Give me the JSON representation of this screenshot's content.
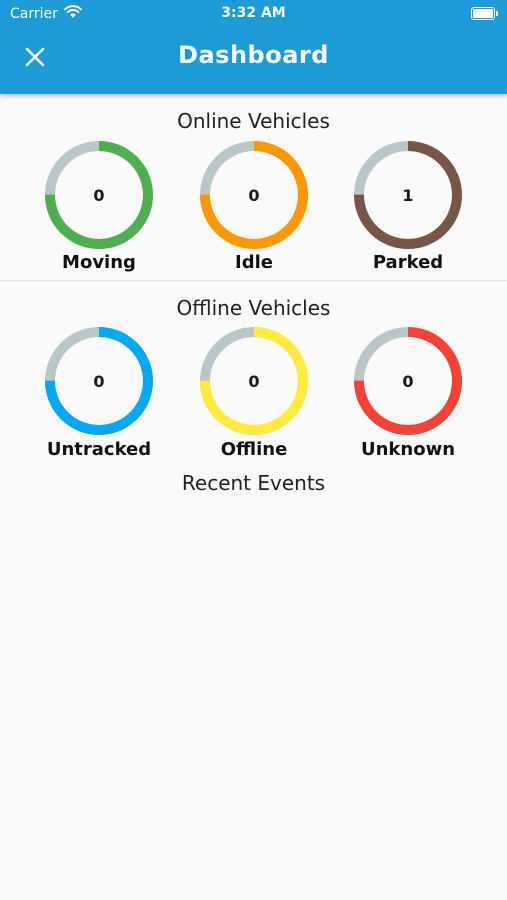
{
  "status_bar": {
    "carrier": "Carrier",
    "time": "3:32 AM"
  },
  "header": {
    "title": "Dashboard",
    "close_icon": "close-icon"
  },
  "colors": {
    "app_bar": "#1c9bd7",
    "track": "#b9c7c9",
    "moving": "#4caf50",
    "idle": "#ff9800",
    "parked": "#795548",
    "untracked": "#03a9f4",
    "offline": "#ffeb3b",
    "unknown": "#f44336"
  },
  "online": {
    "title": "Online Vehicles",
    "items": [
      {
        "label": "Moving",
        "value": "0",
        "color": "#4caf50",
        "progress": 0.75
      },
      {
        "label": "Idle",
        "value": "0",
        "color": "#ff9800",
        "progress": 0.75
      },
      {
        "label": "Parked",
        "value": "1",
        "color": "#795548",
        "progress": 0.75
      }
    ]
  },
  "offline": {
    "title": "Offline Vehicles",
    "items": [
      {
        "label": "Untracked",
        "value": "0",
        "color": "#03a9f4",
        "progress": 0.75
      },
      {
        "label": "Offline",
        "value": "0",
        "color": "#ffeb3b",
        "progress": 0.75
      },
      {
        "label": "Unknown",
        "value": "0",
        "color": "#f44336",
        "progress": 0.75
      }
    ]
  },
  "recent_events": {
    "title": "Recent Events"
  }
}
